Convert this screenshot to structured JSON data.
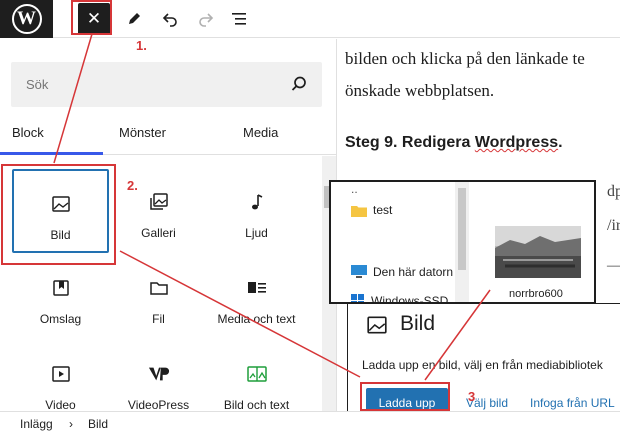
{
  "toolbar": {
    "logo": "W",
    "close_label": "✕",
    "icons": [
      "wordpress-icon",
      "close-icon",
      "pen-icon",
      "undo-icon",
      "redo-icon",
      "list-view-icon"
    ]
  },
  "inserter": {
    "search_placeholder": "Sök",
    "tabs": [
      "Block",
      "Mönster",
      "Media"
    ],
    "active_tab": "Block",
    "blocks": [
      {
        "label": "Bild",
        "icon": "image-icon"
      },
      {
        "label": "Galleri",
        "icon": "gallery-icon"
      },
      {
        "label": "Ljud",
        "icon": "audio-icon"
      },
      {
        "label": "Omslag",
        "icon": "cover-icon"
      },
      {
        "label": "Fil",
        "icon": "file-icon"
      },
      {
        "label": "Media och text",
        "icon": "media-text-icon"
      },
      {
        "label": "Video",
        "icon": "video-icon"
      },
      {
        "label": "VideoPress",
        "icon": "videopress-icon"
      },
      {
        "label": "Bild och text",
        "icon": "image-compare-icon"
      }
    ]
  },
  "breadcrumb": {
    "items": [
      "Inlägg",
      "Bild"
    ],
    "separator": "›"
  },
  "content": {
    "line1": "bilden och klicka på den länkade te",
    "line2": "önskade webbplatsen.",
    "heading_prefix": "Steg 9. Redigera ",
    "heading_word": "Wordpress",
    "heading_suffix": ".",
    "frag1": "dp",
    "frag2": "/ir",
    "frag3": "—"
  },
  "image_block": {
    "title": "Bild",
    "description": "Ladda upp en bild, välj en från mediabibliotek",
    "upload_label": "Ladda upp",
    "select_label": "Välj bild",
    "url_label": "Infoga från URL"
  },
  "explorer": {
    "dots": "..",
    "items": [
      {
        "label": "test",
        "icon": "folder-icon"
      },
      {
        "label": "Den här datorn",
        "icon": "monitor-icon"
      },
      {
        "label": "Windows-SSD",
        "icon": "windows-icon"
      }
    ],
    "file_name": "norrbro600"
  },
  "annotations": {
    "one": "1.",
    "two": "2.",
    "three": "3",
    "color": "#d63638"
  },
  "colors": {
    "accent": "#3858e9",
    "button_blue": "#2271b1",
    "dark": "#1e1e1e"
  }
}
